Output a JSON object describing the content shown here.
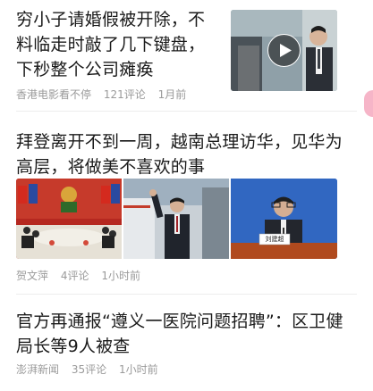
{
  "articles": [
    {
      "title": "穷小子请婚假被开除，不料临走时敲了几下键盘，下秒整个公司瘫痪",
      "source": "香港电影看不停",
      "comments": "121评论",
      "time": "1月前",
      "media": "video"
    },
    {
      "title": "拜登离开不到一周，越南总理访华，见华为高层，将做美不喜欢的事",
      "source": "贺文萍",
      "comments": "4评论",
      "time": "1小时前",
      "nameplate": "刘建超",
      "media": "three-images"
    },
    {
      "title": "官方再通报“遵义一医院问题招聘”：区卫健局长等9人被查",
      "source": "澎湃新闻",
      "comments": "35评论",
      "time": "1小时前",
      "media": "none"
    }
  ],
  "colors": {
    "title": "#1a1a1a",
    "meta": "#9a9a9a",
    "divider": "#ececec",
    "accent_pink": "#f6b5c8"
  }
}
